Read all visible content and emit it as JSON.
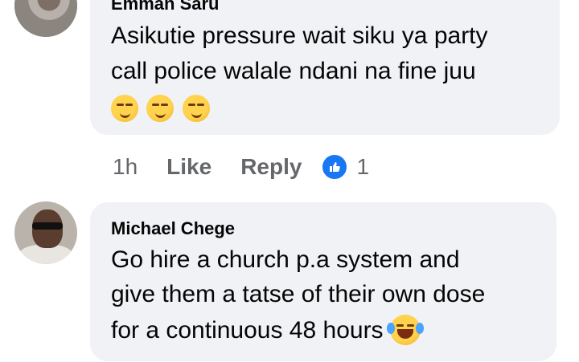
{
  "comments": [
    {
      "author": "Emman Saru",
      "lines": [
        "Asikutie pressure wait siku ya party",
        "call police walale ndani na fine juu"
      ],
      "emoji": [
        "smirk-emoji",
        "smirk-emoji",
        "smirk-emoji"
      ],
      "time": "1h",
      "like_label": "Like",
      "reply_label": "Reply",
      "reaction_icon": "thumbs-up-icon",
      "reaction_count": "1"
    },
    {
      "author": "Michael Chege",
      "lines": [
        "Go hire a church p.a system and",
        "give them a tatse of their own dose",
        "for a continuous 48 hours"
      ],
      "emoji": [
        "tears-of-joy-emoji"
      ]
    }
  ],
  "colors": {
    "bubble": "#f0f2f5",
    "meta": "#65676b",
    "accent": "#1877f2"
  }
}
